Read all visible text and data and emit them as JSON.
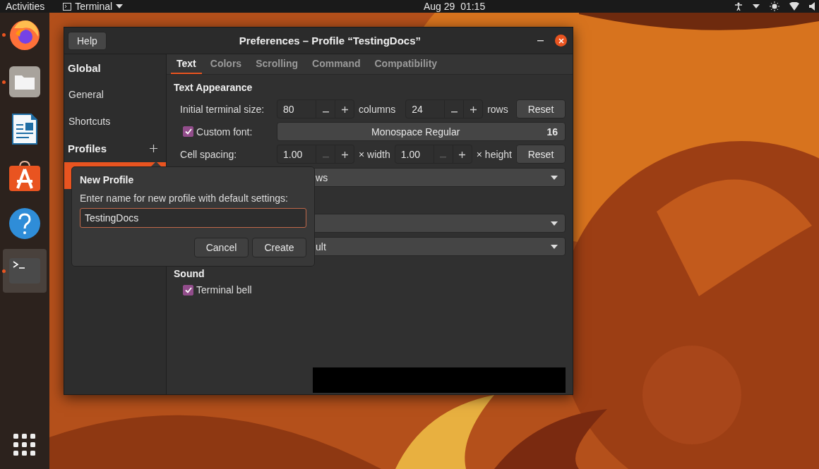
{
  "top_bar": {
    "activities": "Activities",
    "app_menu": "Terminal",
    "clock": "Aug 29  01:15"
  },
  "dock": {
    "items": [
      {
        "kind": "firefox",
        "running": true,
        "selected": false
      },
      {
        "kind": "files",
        "running": true,
        "selected": false
      },
      {
        "kind": "writer",
        "running": false,
        "selected": false
      },
      {
        "kind": "software",
        "running": false,
        "selected": false
      },
      {
        "kind": "help",
        "running": false,
        "selected": false
      },
      {
        "kind": "terminal",
        "running": true,
        "selected": true
      }
    ]
  },
  "window": {
    "help_button": "Help",
    "title": "Preferences – Profile “TestingDocs”",
    "sidebar": {
      "items": [
        {
          "kind": "heading",
          "label": "Global"
        },
        {
          "kind": "item",
          "label": "General",
          "selected": false
        },
        {
          "kind": "item",
          "label": "Shortcuts",
          "selected": false
        },
        {
          "kind": "heading",
          "label": "Profiles"
        },
        {
          "kind": "profile",
          "selected": true
        }
      ]
    },
    "tabs": [
      {
        "label": "Text",
        "selected": true
      },
      {
        "label": "Colors",
        "selected": false
      },
      {
        "label": "Scrolling",
        "selected": false
      },
      {
        "label": "Command",
        "selected": false
      },
      {
        "label": "Compatibility",
        "selected": false
      }
    ],
    "text_appearance": {
      "heading": "Text Appearance",
      "size": {
        "label": "Initial terminal size:",
        "columns": {
          "value": "80",
          "decrement_disabled": false
        },
        "columns_unit": "columns",
        "rows": {
          "value": "24",
          "decrement_disabled": false
        },
        "rows_unit": "rows",
        "reset": "Reset"
      },
      "custom_font": {
        "checked": true,
        "label": "Custom font:",
        "font": "Monospace Regular",
        "size": "16"
      },
      "cell_spacing": {
        "label": "Cell spacing:",
        "width": {
          "value": "1.00",
          "decrement_disabled": true
        },
        "width_unit": "× width",
        "height": {
          "value": "1.00",
          "decrement_disabled": true
        },
        "height_unit": "× height",
        "reset": "Reset"
      },
      "dropdowns": [
        {
          "kind": "text",
          "value": "ws"
        },
        {
          "kind": "empty"
        },
        {
          "kind": "text",
          "value": "ult"
        }
      ]
    },
    "sound": {
      "heading": "Sound",
      "bell": {
        "label": "Terminal bell",
        "checked": true
      }
    },
    "popover": {
      "title": "New Profile",
      "prompt": "Enter name for new profile with default settings:",
      "value": "TestingDocs",
      "cancel": "Cancel",
      "create": "Create"
    }
  }
}
